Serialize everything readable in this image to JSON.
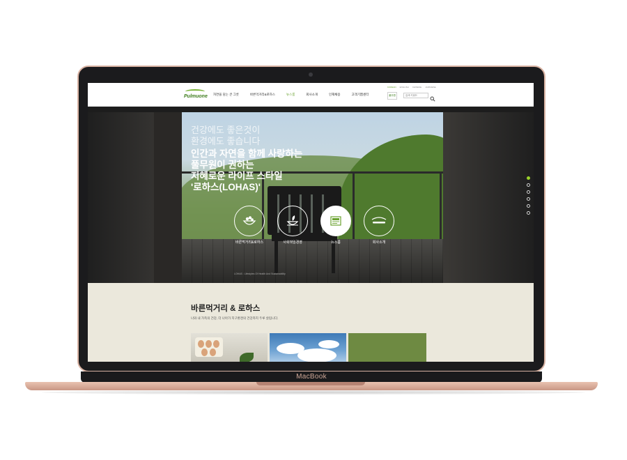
{
  "device": {
    "label": "MacBook"
  },
  "site": {
    "logo": "Pulmuone",
    "nav": [
      {
        "label": "자연을 담는 큰 그릇",
        "active": false
      },
      {
        "label": "바른먹거리&로하스",
        "active": false
      },
      {
        "label": "뉴스룸",
        "active": true
      },
      {
        "label": "회사소개",
        "active": false
      },
      {
        "label": "인재채용",
        "active": false
      },
      {
        "label": "고객기쁨센터",
        "active": false
      }
    ],
    "languages": [
      {
        "label": "KOREAN",
        "active": true
      },
      {
        "label": "ENGLISH",
        "active": false
      },
      {
        "label": "CHINESE",
        "active": false
      },
      {
        "label": "JAPANESE",
        "active": false
      }
    ],
    "badge": "풀무원",
    "search": {
      "placeholder": "검색 키워드"
    }
  },
  "hero": {
    "headline_small": [
      "건강에도 좋은것이",
      "환경에도 좋습니다"
    ],
    "headline_main": [
      "인간과 자연을 함께 사랑하는",
      "풀무원이 권하는",
      "지혜로운 라이프 스타일",
      "'로하스(LOHAS)'"
    ],
    "circle_menu": [
      {
        "label": "바른먹거리&로하스",
        "icon": "salad-bowl-icon",
        "active": false
      },
      {
        "label": "사회책임경영",
        "icon": "leaf-bowl-icon",
        "active": false
      },
      {
        "label": "뉴스룸",
        "icon": "news-icon",
        "active": true
      },
      {
        "label": "회사소개",
        "icon": "pulmuone-logo-icon",
        "active": false
      }
    ],
    "caption": "LOHAS : Lifestyles Of Health And Sustainability",
    "dots": [
      true,
      false,
      false,
      false,
      false,
      false
    ]
  },
  "section": {
    "title": "바른먹거리 & 로하스",
    "desc": "나와 내 가족의 건강, 더 나아가 지구환경의 건강까지 두루 살핍니다."
  },
  "colors": {
    "accent": "#6aa230",
    "dot_active": "#9bd22b",
    "section_bg": "#ebe8dc"
  }
}
